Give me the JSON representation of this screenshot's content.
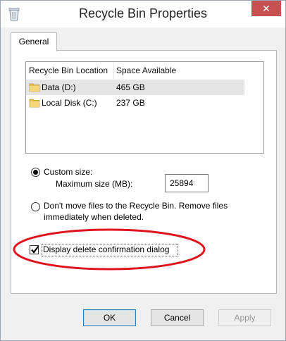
{
  "window": {
    "title": "Recycle Bin Properties",
    "close_glyph": "✕",
    "title_icon": "recycle-bin-icon"
  },
  "tabs": [
    {
      "label": "General",
      "active": true
    }
  ],
  "locations": {
    "columns": [
      "Recycle Bin Location",
      "Space Available"
    ],
    "rows": [
      {
        "name": "Data (D:)",
        "space": "465 GB",
        "icon": "folder-icon",
        "selected": true
      },
      {
        "name": "Local Disk (C:)",
        "space": "237 GB",
        "icon": "folder-icon",
        "selected": false
      }
    ]
  },
  "settings": {
    "custom_size_label": "Custom size:",
    "max_size_label": "Maximum size (MB):",
    "max_size_value": "25894",
    "dont_move_label_line1": "Don't move files to the Recycle Bin. Remove files",
    "dont_move_label_line2": "immediately when deleted.",
    "custom_size_selected": true,
    "display_confirm_label": "Display delete confirmation dialog",
    "display_confirm_checked": true
  },
  "buttons": {
    "ok": "OK",
    "cancel": "Cancel",
    "apply": "Apply"
  },
  "colors": {
    "highlight_ellipse": "#e0141c",
    "close_button": "#c75050"
  }
}
